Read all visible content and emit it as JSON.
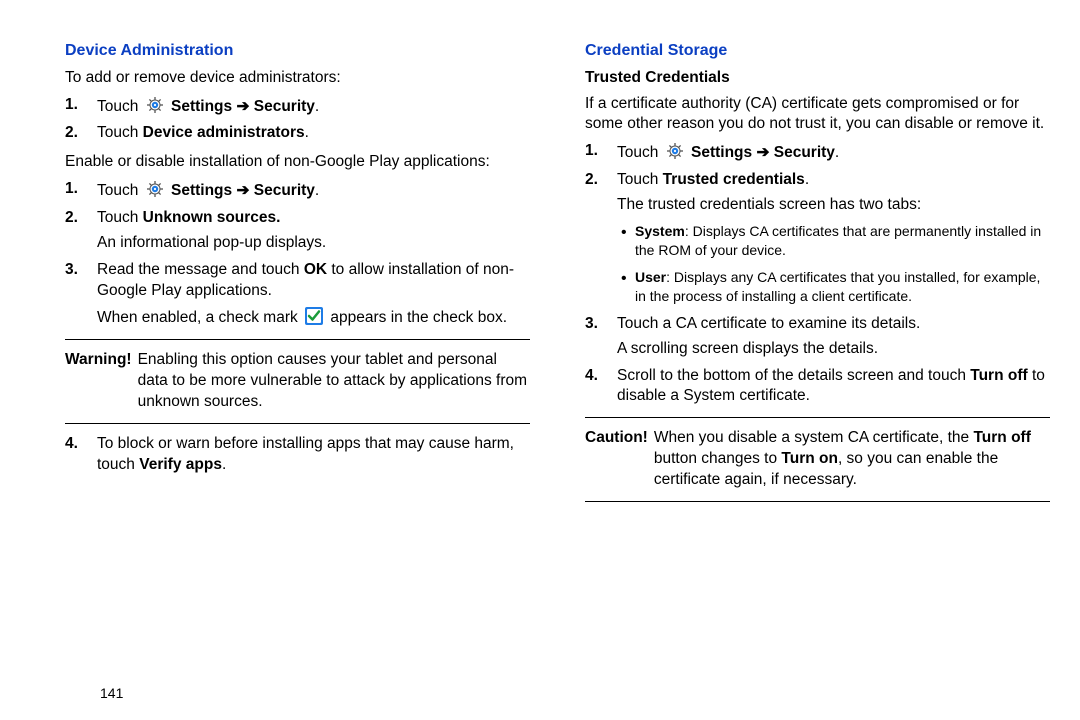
{
  "left": {
    "heading": "Device Administration",
    "intro1": "To add or remove device administrators:",
    "steps1": {
      "s1_pre": "Touch ",
      "s1_bold1": "Settings",
      "s1_arrow": " ➔ ",
      "s1_bold2": "Security",
      "s1_post": ".",
      "s2_pre": "Touch ",
      "s2_bold": "Device administrators",
      "s2_post": "."
    },
    "intro2": "Enable or disable installation of non-Google Play applications:",
    "steps2": {
      "s1_pre": "Touch ",
      "s1_bold1": "Settings",
      "s1_arrow": " ➔ ",
      "s1_bold2": "Security",
      "s1_post": ".",
      "s2_pre": "Touch ",
      "s2_bold": "Unknown sources.",
      "s2_sub": "An informational pop-up displays.",
      "s3_pre": "Read the message and touch ",
      "s3_bold": "OK",
      "s3_post": " to allow installation of non-Google Play applications.",
      "s3_sub_pre": "When enabled, a check mark ",
      "s3_sub_post": " appears in the check box.",
      "s4_pre": "To block or warn before installing apps that may cause harm, touch ",
      "s4_bold": "Verify apps",
      "s4_post": "."
    },
    "warning": {
      "label": "Warning!",
      "text": "Enabling this option causes your tablet and personal data to be more vulnerable to attack by applications from unknown sources."
    }
  },
  "right": {
    "heading": "Credential Storage",
    "subheading": "Trusted Credentials",
    "intro": "If a certificate authority (CA) certificate gets compromised or for some other reason you do not trust it, you can disable or remove it.",
    "steps": {
      "s1_pre": "Touch ",
      "s1_bold1": "Settings",
      "s1_arrow": " ➔ ",
      "s1_bold2": "Security",
      "s1_post": ".",
      "s2_pre": "Touch ",
      "s2_bold": "Trusted credentials",
      "s2_post": ".",
      "s2_sub": "The trusted credentials screen has two tabs:",
      "b1_bold": "System",
      "b1_text": ": Displays CA certificates that are permanently installed in the ROM of your device.",
      "b2_bold": "User",
      "b2_text": ": Displays any CA certificates that you installed, for example, in the process of installing a client certificate.",
      "s3_line1": "Touch a CA certificate to examine its details.",
      "s3_line2": "A scrolling screen displays the details.",
      "s4_pre": "Scroll to the bottom of the details screen and touch ",
      "s4_bold": "Turn off",
      "s4_post": " to disable a System certificate."
    },
    "caution": {
      "label": "Caution!",
      "pre": "When you disable a system CA certificate, the ",
      "bold1": "Turn off",
      "mid": " button changes to ",
      "bold2": "Turn on",
      "post": ", so you can enable the certificate again, if necessary."
    }
  },
  "pageNumber": "141"
}
